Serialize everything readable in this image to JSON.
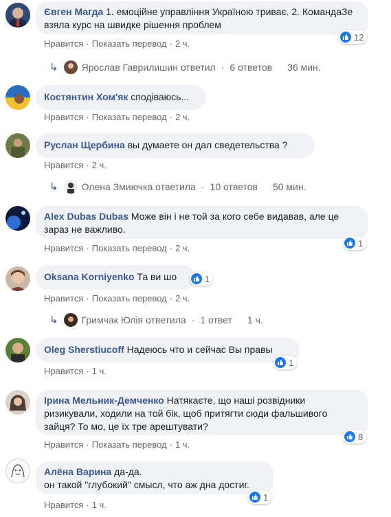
{
  "comments": [
    {
      "author": "Євген Магда",
      "text": "1. емоційне управління Україною триває. 2. КомандаЗе взяла курс на швидке рішення проблем",
      "like": "Нравится",
      "translate": "Показать перевод",
      "time": "2 ч.",
      "reactions": "12",
      "reply": {
        "name": "Ярослав Гаврилишин ответил",
        "count": "6 ответов",
        "time": "36 мин."
      }
    },
    {
      "author": "Костянтин Хом'як",
      "text": "сподіваюсь...",
      "like": "Нравится",
      "translate": "Показать перевод",
      "time": "2 ч."
    },
    {
      "author": "Руслан Щербина",
      "text": "вы думаете он дал сведетельства ?",
      "like": "Нравится",
      "time": "2 ч.",
      "reply": {
        "name": "Олена Змиючка ответила",
        "count": "10 ответов",
        "time": "50 мин."
      }
    },
    {
      "author": "Alex Dubas Dubas",
      "text": "Може він і не той за кого себе видавав, але це зараз не важливо.",
      "like": "Нравится",
      "translate": "Показать перевод",
      "time": "2 ч.",
      "reactions": "1"
    },
    {
      "author": "Oksana Korniyenko",
      "text": "Та ви шо",
      "like": "Нравится",
      "translate": "Показать перевод",
      "time": "2 ч.",
      "reactions": "1",
      "reply": {
        "name": "Гримчак Юлія ответила",
        "count": "1 ответ",
        "time": "1 ч."
      }
    },
    {
      "author": "Oleg Sherstiucoff",
      "text": "Надеюсь что и сейчас Вы правы",
      "like": "Нравится",
      "time": "1 ч.",
      "reactions": "1"
    },
    {
      "author": "Ірина Мельник-Демченко",
      "text": "Натякаєте, що наші розвідники ризикували, ходили на той бік, щоб притягти сюди фальшивого зайця? То мо, це їх тре арештувати?",
      "like": "Нравится",
      "translate": "Показать перевод",
      "time": "1 ч.",
      "reactions": "8"
    },
    {
      "author": "Алёна Варина",
      "text": "да-да.",
      "text2": "он такой \"глубокий\" смысл, что аж дна достиг.",
      "like": "Нравится",
      "time": "1 ч.",
      "reactions": "1"
    }
  ],
  "colors": {
    "link": "#385898",
    "bubble": "#f0f2f5",
    "like_blue": "#1877f2",
    "meta": "#65676b"
  }
}
